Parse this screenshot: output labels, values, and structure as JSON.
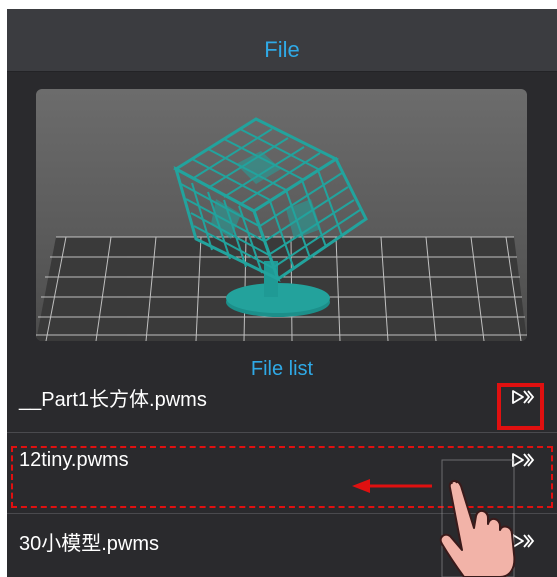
{
  "header": {
    "title": "File"
  },
  "preview": {
    "alt": "3d-model-preview-image"
  },
  "file_list": {
    "title": "File list",
    "items": [
      {
        "name": "__Part1长方体.pwms"
      },
      {
        "name": "12tiny.pwms"
      },
      {
        "name": "30小模型.pwms"
      }
    ]
  },
  "colors": {
    "accent": "#2fa9e6",
    "background": "#2a2a2d",
    "header": "#3b3c40",
    "annotation": "#e01010",
    "model": "#1f9a95"
  }
}
